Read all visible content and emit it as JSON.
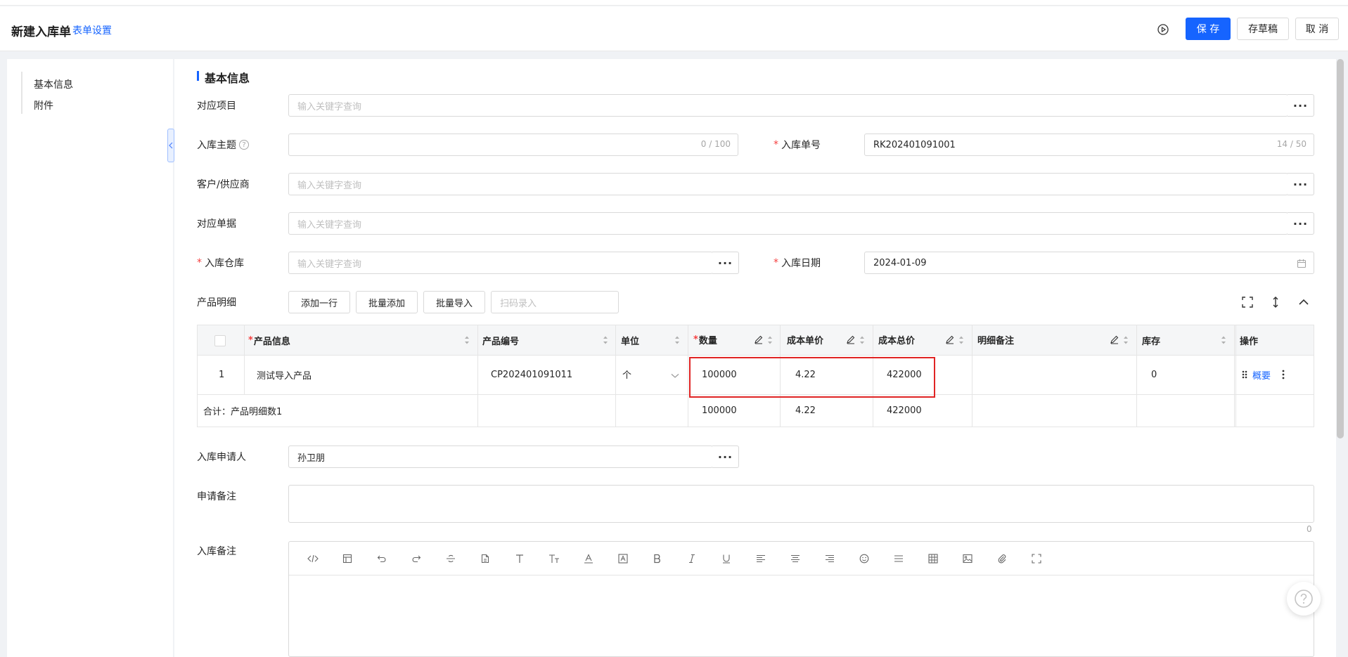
{
  "header": {
    "title": "新建入库单",
    "form_settings": "表单设置",
    "save": "保 存",
    "draft": "存草稿",
    "cancel": "取 消"
  },
  "sidebar": {
    "items": [
      {
        "label": "基本信息"
      },
      {
        "label": "附件"
      }
    ]
  },
  "section": {
    "title": "基本信息"
  },
  "form": {
    "project": {
      "label": "对应项目",
      "placeholder": "输入关键字查询"
    },
    "subject": {
      "label": "入库主题",
      "value": "",
      "counter": "0 / 100"
    },
    "order_no": {
      "label": "入库单号",
      "value": "RK202401091001",
      "counter": "14 / 50"
    },
    "customer": {
      "label": "客户/供应商",
      "placeholder": "输入关键字查询"
    },
    "document": {
      "label": "对应单据",
      "placeholder": "输入关键字查询"
    },
    "warehouse": {
      "label": "入库仓库",
      "placeholder": "输入关键字查询"
    },
    "date": {
      "label": "入库日期",
      "value": "2024-01-09"
    },
    "product_detail": {
      "label": "产品明细"
    },
    "applicant": {
      "label": "入库申请人",
      "value": "孙卫朋"
    },
    "apply_remark": {
      "label": "申请备注",
      "counter": "0"
    },
    "stock_remark": {
      "label": "入库备注"
    }
  },
  "product_tools": {
    "add_row": "添加一行",
    "batch_add": "批量添加",
    "batch_import": "批量导入",
    "scan_placeholder": "扫码录入"
  },
  "table": {
    "headers": {
      "product_info": "产品信息",
      "product_code": "产品编号",
      "unit": "单位",
      "quantity": "数量",
      "unit_cost": "成本单价",
      "total_cost": "成本总价",
      "detail_remark": "明细备注",
      "stock": "库存",
      "action": "操作"
    },
    "rows": [
      {
        "index": "1",
        "product_info": "测试导入产品",
        "product_code": "CP202401091011",
        "unit": "个",
        "quantity": "100000",
        "unit_cost": "4.22",
        "total_cost": "422000",
        "detail_remark": "",
        "stock": "0",
        "action": "概要"
      }
    ],
    "summary": {
      "label": "合计：产品明细数1",
      "quantity": "100000",
      "unit_cost": "4.22",
      "total_cost": "422000"
    }
  },
  "rich_toolbar": [
    "code-icon",
    "template-icon",
    "undo-icon",
    "redo-icon",
    "strikethrough-icon",
    "file-icon",
    "font-icon",
    "font-size-icon",
    "font-color-icon",
    "background-color-icon",
    "bold-icon",
    "italic-icon",
    "underline-icon",
    "align-left-icon",
    "align-center-icon",
    "align-right-icon",
    "emoji-icon",
    "line-height-icon",
    "table-icon",
    "image-icon",
    "attachment-icon",
    "fullscreen-icon"
  ],
  "colors": {
    "primary": "#1664ff",
    "required": "#f53f3f",
    "highlight": "#e02424"
  }
}
